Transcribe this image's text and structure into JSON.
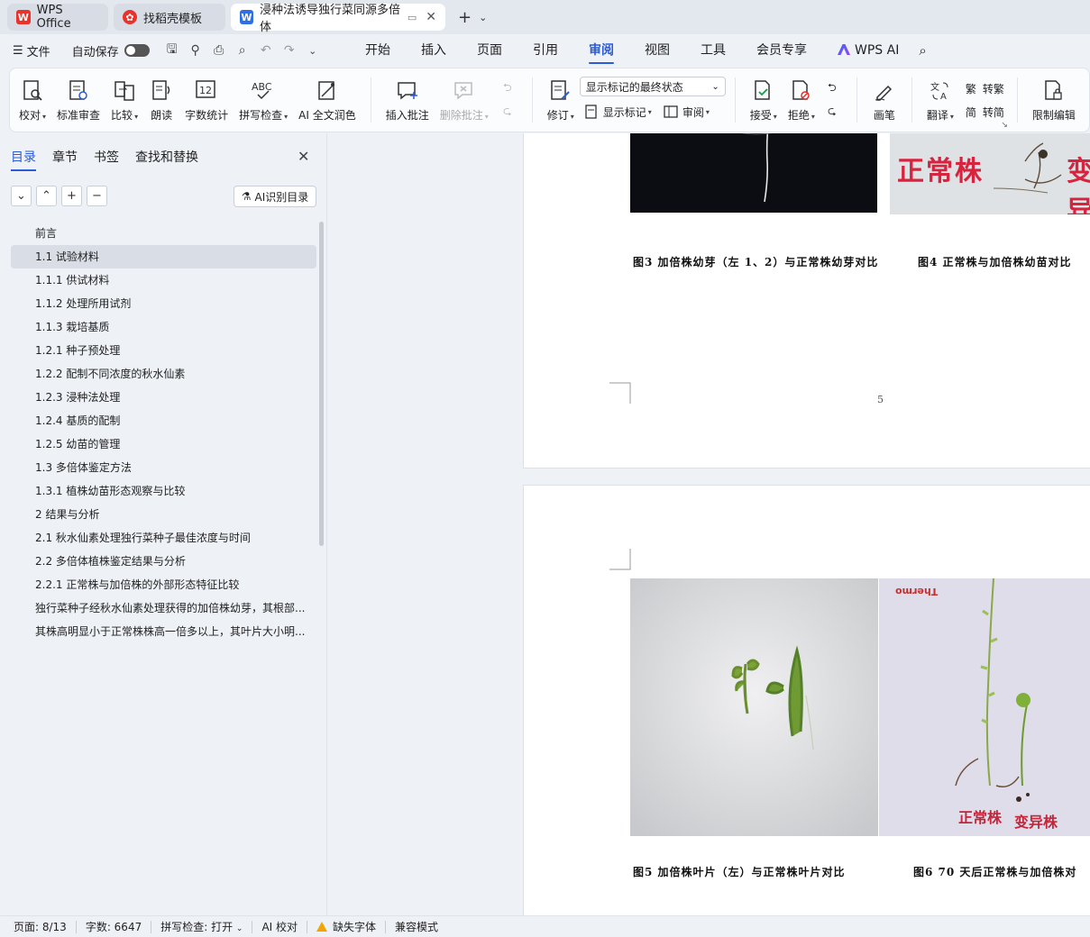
{
  "titlebar": {
    "tabs": [
      {
        "label": "WPS Office",
        "icon": "wps-logo-icon",
        "active": false
      },
      {
        "label": "找稻壳模板",
        "icon": "docer-icon",
        "active": false
      },
      {
        "label": "浸种法诱导独行菜同源多倍体",
        "icon": "word-doc-icon",
        "active": true
      }
    ]
  },
  "menubar": {
    "file_label": "文件",
    "autosave_label": "自动保存",
    "tabs": [
      "开始",
      "插入",
      "页面",
      "引用",
      "审阅",
      "视图",
      "工具",
      "会员专享"
    ],
    "active_tab": "审阅",
    "wps_ai_label": "WPS AI"
  },
  "ribbon": {
    "proofread": "校对",
    "standard_review": "标准审查",
    "compare": "比较",
    "read_aloud": "朗读",
    "word_count": "字数统计",
    "spell_check": "拼写检查",
    "ai_polish": "AI 全文润色",
    "insert_comment": "插入批注",
    "delete_comment": "删除批注",
    "track_changes": "修订",
    "markup_select": "显示标记的最终状态",
    "show_markup": "显示标记",
    "review": "审阅",
    "accept": "接受",
    "reject": "拒绝",
    "pen": "画笔",
    "translate": "翻译",
    "to_traditional": "转繁",
    "to_simplified": "转简",
    "restrict_edit": "限制编辑"
  },
  "navpane": {
    "tabs": [
      "目录",
      "章节",
      "书签",
      "查找和替换"
    ],
    "active_tab": "目录",
    "ai_toc_label": "AI识别目录",
    "toc": [
      "前言",
      "1.1  试验材料",
      "1.1.1  供试材料",
      "1.1.2  处理所用试剂",
      "1.1.3  栽培基质",
      "1.2.1  种子预处理",
      "1.2.2  配制不同浓度的秋水仙素",
      "1.2.3  浸种法处理",
      "1.2.4  基质的配制",
      "1.2.5  幼苗的管理",
      "1.3  多倍体鉴定方法",
      "1.3.1  植株幼苗形态观察与比较",
      "2 结果与分析",
      "2.1  秋水仙素处理独行菜种子最佳浓度与时间",
      "2.2  多倍体植株鉴定结果与分析",
      "2.2.1  正常株与加倍株的外部形态特征比较",
      "独行菜种子经秋水仙素处理获得的加倍株幼芽，其根部...",
      "其株高明显小于正常株株高一倍多以上，其叶片大小明..."
    ],
    "selected_index": 1
  },
  "document": {
    "page1": {
      "photo_text": "正常株",
      "photo_text2": "变异",
      "caption3": "图3   加倍株幼芽（左 1、2）与正常株幼芽对比",
      "caption4": "图4   正常株与加倍株幼苗对比",
      "page_number": "5"
    },
    "page2": {
      "photo_label_a": "正常株",
      "photo_label_b": "变异株",
      "photo_label_c": "Thermo",
      "caption5": "图5   加倍株叶片（左）与正常株叶片对比",
      "caption6": "图6   70 天后正常株与加倍株对"
    }
  },
  "statusbar": {
    "page": "页面: 8/13",
    "words": "字数: 6647",
    "spell": "拼写检查: 打开",
    "ai_proof": "AI 校对",
    "missing_font": "缺失字体",
    "compat": "兼容模式"
  },
  "colors": {
    "accent": "#2b5bd7",
    "wps_red": "#e8322b",
    "doc_blue": "#2f6fe4"
  }
}
